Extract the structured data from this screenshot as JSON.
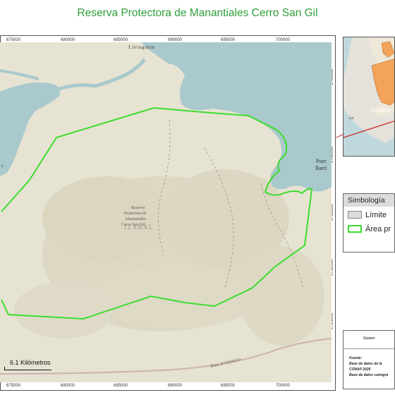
{
  "title": "Reserva Protectora de Manantiales Cerro San Gil",
  "colors": {
    "title_green": "#2f9e3a",
    "boundary_green": "#3ddc2f",
    "water": "#a9c9cc",
    "land": "#e7e3d2",
    "hills": "#d6d2bd",
    "inset_orange": "#f4a35b",
    "red_pointer": "#cc2222"
  },
  "map": {
    "places": {
      "livingston": "Livingston",
      "reserve_label_1": "Reserva",
      "reserve_label_2": "Protectora de",
      "reserve_label_3": "Manantiales",
      "reserve_label_4": "Cerro San Gil",
      "department": "IZABAL",
      "puerto_1": "Puer",
      "puerto_2": "Barri",
      "road": "Ruta al Atlántico",
      "lake_fragment": "k"
    },
    "ticks_top": [
      "675000",
      "680000",
      "685000",
      "690000",
      "695000",
      "700000"
    ],
    "ticks_bottom": [
      "675000",
      "680000",
      "685000",
      "690000",
      "695000",
      "700000"
    ],
    "ticks_right": [
      "1745000",
      "1740000",
      "1735000",
      "1730000",
      "1725000"
    ],
    "scale_label": "6.1 Kilómetros"
  },
  "inset": {
    "label": "Guate",
    "fragment": "cor"
  },
  "legend": {
    "title": "Simbología",
    "items": [
      "Límite",
      "Área pr"
    ]
  },
  "info": {
    "header": "Sistem",
    "source_label": "Fuente:",
    "lines": [
      "Base de datos de la",
      "CONAP 2026",
      "Base de datos cartogra"
    ]
  }
}
